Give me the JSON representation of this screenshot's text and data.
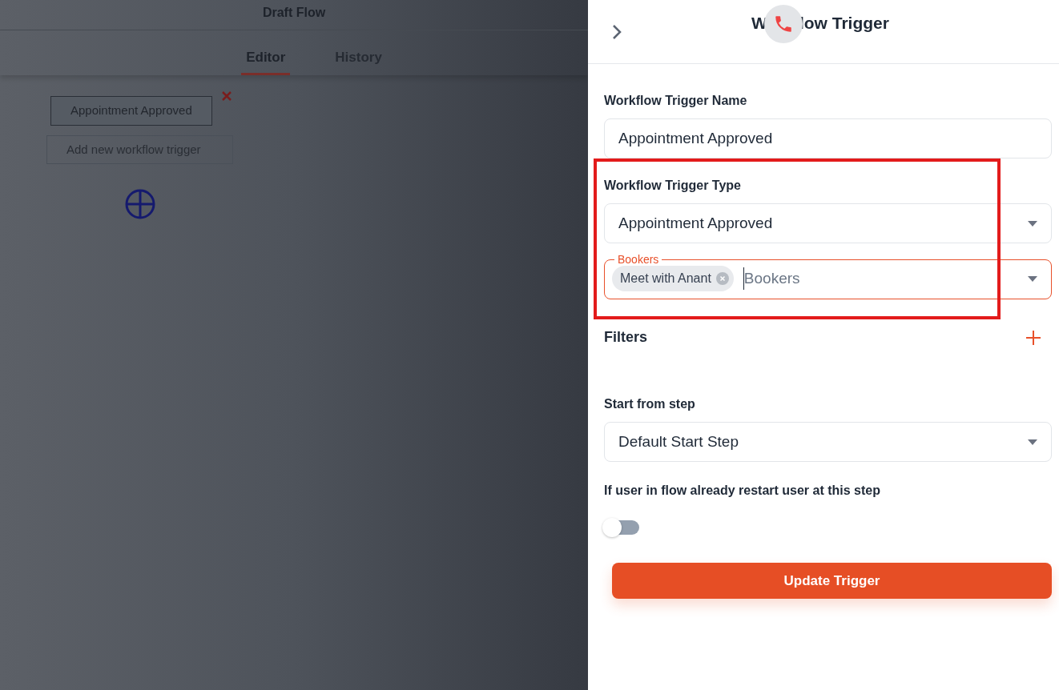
{
  "flow": {
    "title": "Draft Flow",
    "tabs": [
      {
        "label": "Editor",
        "selected": true
      },
      {
        "label": "History",
        "selected": false
      }
    ],
    "nodes": [
      {
        "kind": "trigger",
        "label": "Appointment Approved"
      },
      {
        "kind": "add",
        "label": "Add new workflow trigger"
      }
    ]
  },
  "panel": {
    "title_parts": [
      "W",
      "low Trigger"
    ],
    "name_field": {
      "label": "Workflow Trigger Name",
      "value": "Appointment Approved"
    },
    "type_field": {
      "label": "Workflow Trigger Type",
      "value": "Appointment Approved"
    },
    "bookers_field": {
      "label": "Bookers",
      "placeholder": "Bookers",
      "focused": true,
      "chips": [
        "Meet with Anant"
      ]
    },
    "filters": {
      "label": "Filters"
    },
    "start_field": {
      "label": "Start from step",
      "value": "Default Start Step"
    },
    "restart_toggle": {
      "label": "If user in flow already restart user at this step",
      "on": false
    },
    "submit": "Update Trigger"
  }
}
